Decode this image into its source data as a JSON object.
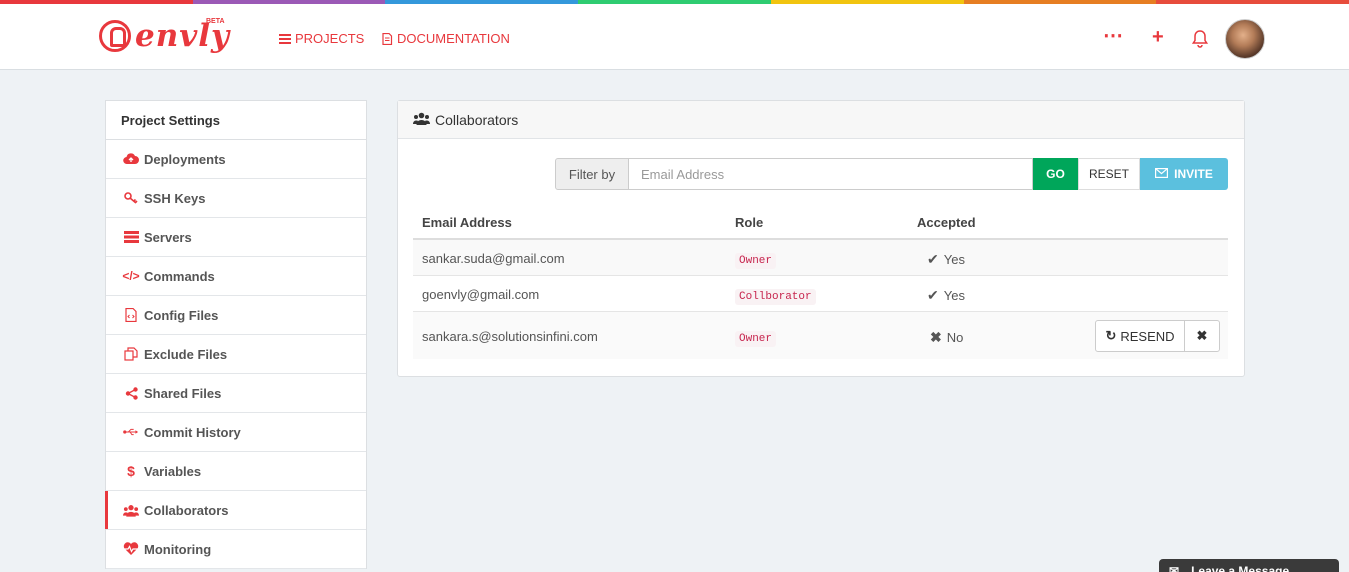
{
  "rainbow_colors": [
    "#e8383d",
    "#9b59b6",
    "#3498db",
    "#2ecc71",
    "#f1c40f",
    "#e67e22",
    "#e74c3c"
  ],
  "header": {
    "brand": "envly",
    "beta": "BETA",
    "nav": [
      {
        "label": "PROJECTS",
        "icon": "list-icon"
      },
      {
        "label": "DOCUMENTATION",
        "icon": "file-icon"
      }
    ],
    "icons": [
      "ellipsis-icon",
      "plus-icon",
      "bell-icon"
    ],
    "accent_color": "#e8383d"
  },
  "sidebar": {
    "title": "Project Settings",
    "items": [
      {
        "label": "Deployments",
        "icon": "cloud-upload-icon"
      },
      {
        "label": "SSH Keys",
        "icon": "key-icon"
      },
      {
        "label": "Servers",
        "icon": "server-icon"
      },
      {
        "label": "Commands",
        "icon": "code-icon"
      },
      {
        "label": "Config Files",
        "icon": "file-code-icon"
      },
      {
        "label": "Exclude Files",
        "icon": "files-icon"
      },
      {
        "label": "Shared Files",
        "icon": "share-icon"
      },
      {
        "label": "Commit History",
        "icon": "usb-icon"
      },
      {
        "label": "Variables",
        "icon": "dollar-icon"
      },
      {
        "label": "Collaborators",
        "icon": "users-icon",
        "active": true
      },
      {
        "label": "Monitoring",
        "icon": "heartbeat-icon"
      }
    ]
  },
  "panel": {
    "title": "Collaborators",
    "filter": {
      "label": "Filter by",
      "placeholder": "Email Address",
      "go": "GO",
      "reset": "RESET",
      "invite": "INVITE"
    },
    "table": {
      "headers": [
        "Email Address",
        "Role",
        "Accepted"
      ],
      "rows": [
        {
          "email": "sankar.suda@gmail.com",
          "role": "Owner",
          "accepted": "Yes"
        },
        {
          "email": "goenvly@gmail.com",
          "role": "Collborator",
          "accepted": "Yes"
        },
        {
          "email": "sankara.s@solutionsinfini.com",
          "role": "Owner",
          "accepted": "No",
          "actions": {
            "resend": "RESEND"
          }
        }
      ]
    }
  },
  "chat": {
    "label": "Leave a Message"
  }
}
